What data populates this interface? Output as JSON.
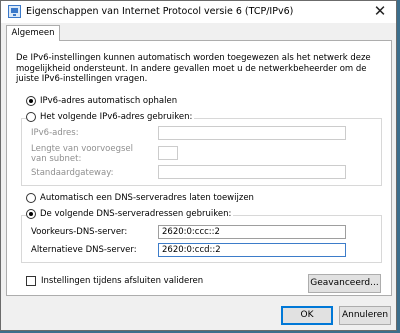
{
  "window": {
    "title": "Eigenschappen van Internet Protocol versie 6 (TCP/IPv6)",
    "close_glyph": "✕"
  },
  "tabs": [
    {
      "label": "Algemeen"
    }
  ],
  "intro": "De IPv6-instellingen kunnen automatisch worden toegewezen als het netwerk deze mogelijkheid ondersteunt. In andere gevallen moet u de netwerkbeheerder om de juiste IPv6-instellingen vragen.",
  "ip": {
    "auto_label": "IPv6-adres automatisch ophalen",
    "auto_selected": true,
    "manual_label": "Het volgende IPv6-adres gebruiken:",
    "fields": {
      "address_label": "IPv6-adres:",
      "address_value": "",
      "prefix_label": "Lengte van voorvoegsel van subnet:",
      "prefix_value": "",
      "gateway_label": "Standaardgateway:",
      "gateway_value": ""
    }
  },
  "dns": {
    "auto_label": "Automatisch een DNS-serveradres laten toewijzen",
    "manual_label": "De volgende DNS-serveradressen gebruiken:",
    "manual_selected": true,
    "preferred_label": "Voorkeurs-DNS-server:",
    "preferred_value": "2620:0:ccc::2",
    "alternate_label": "Alternatieve DNS-server:",
    "alternate_value": "2620:0:ccd::2"
  },
  "validate_label": "Instellingen tijdens afsluiten valideren",
  "validate_checked": false,
  "advanced_button": "Geavanceerd...",
  "ok_button": "OK",
  "cancel_button": "Annuleren",
  "colors": {
    "focus": "#3d7cc9",
    "primary_border": "#0078d7",
    "disabled_text": "#8f8f8f"
  }
}
